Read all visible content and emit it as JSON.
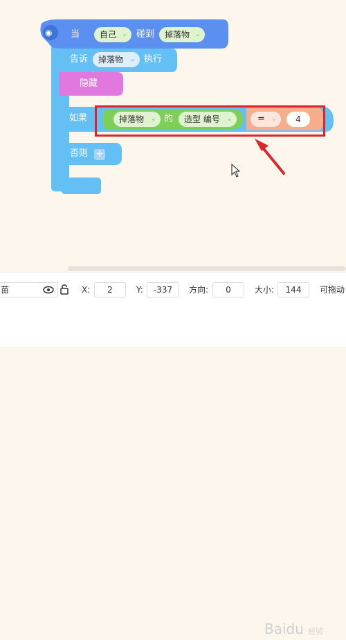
{
  "event_block": {
    "label": "当",
    "sprite": "自己",
    "action": "碰到",
    "target": "掉落物"
  },
  "tell_block": {
    "label": "告诉",
    "target": "掉落物",
    "action": "执行"
  },
  "hide_block": {
    "label": "隐藏"
  },
  "if_block": {
    "label": "如果",
    "sensor_sprite": "掉落物",
    "of_label": "的",
    "sensor_property": "造型 编号",
    "operator": "=",
    "value": "4"
  },
  "else_block": {
    "label": "否则",
    "add_symbol": "+"
  },
  "properties_bar": {
    "name_partial": "苗",
    "x_label": "X:",
    "x_value": "2",
    "y_label": "Y:",
    "y_value": "-337",
    "direction_label": "方向:",
    "direction_value": "0",
    "size_label": "大小:",
    "size_value": "144",
    "draggable_label": "可拖动"
  },
  "watermark": {
    "text": "Baidu",
    "sub": "经验"
  },
  "colors": {
    "background": "#fdf6ec",
    "event_block": "#5b8ff0",
    "control_block": "#64bff5",
    "looks_block": "#e277e0",
    "sensing_block": "#7dcf5a",
    "operator_block": "#f6ad8c",
    "highlight": "#d9262b"
  }
}
